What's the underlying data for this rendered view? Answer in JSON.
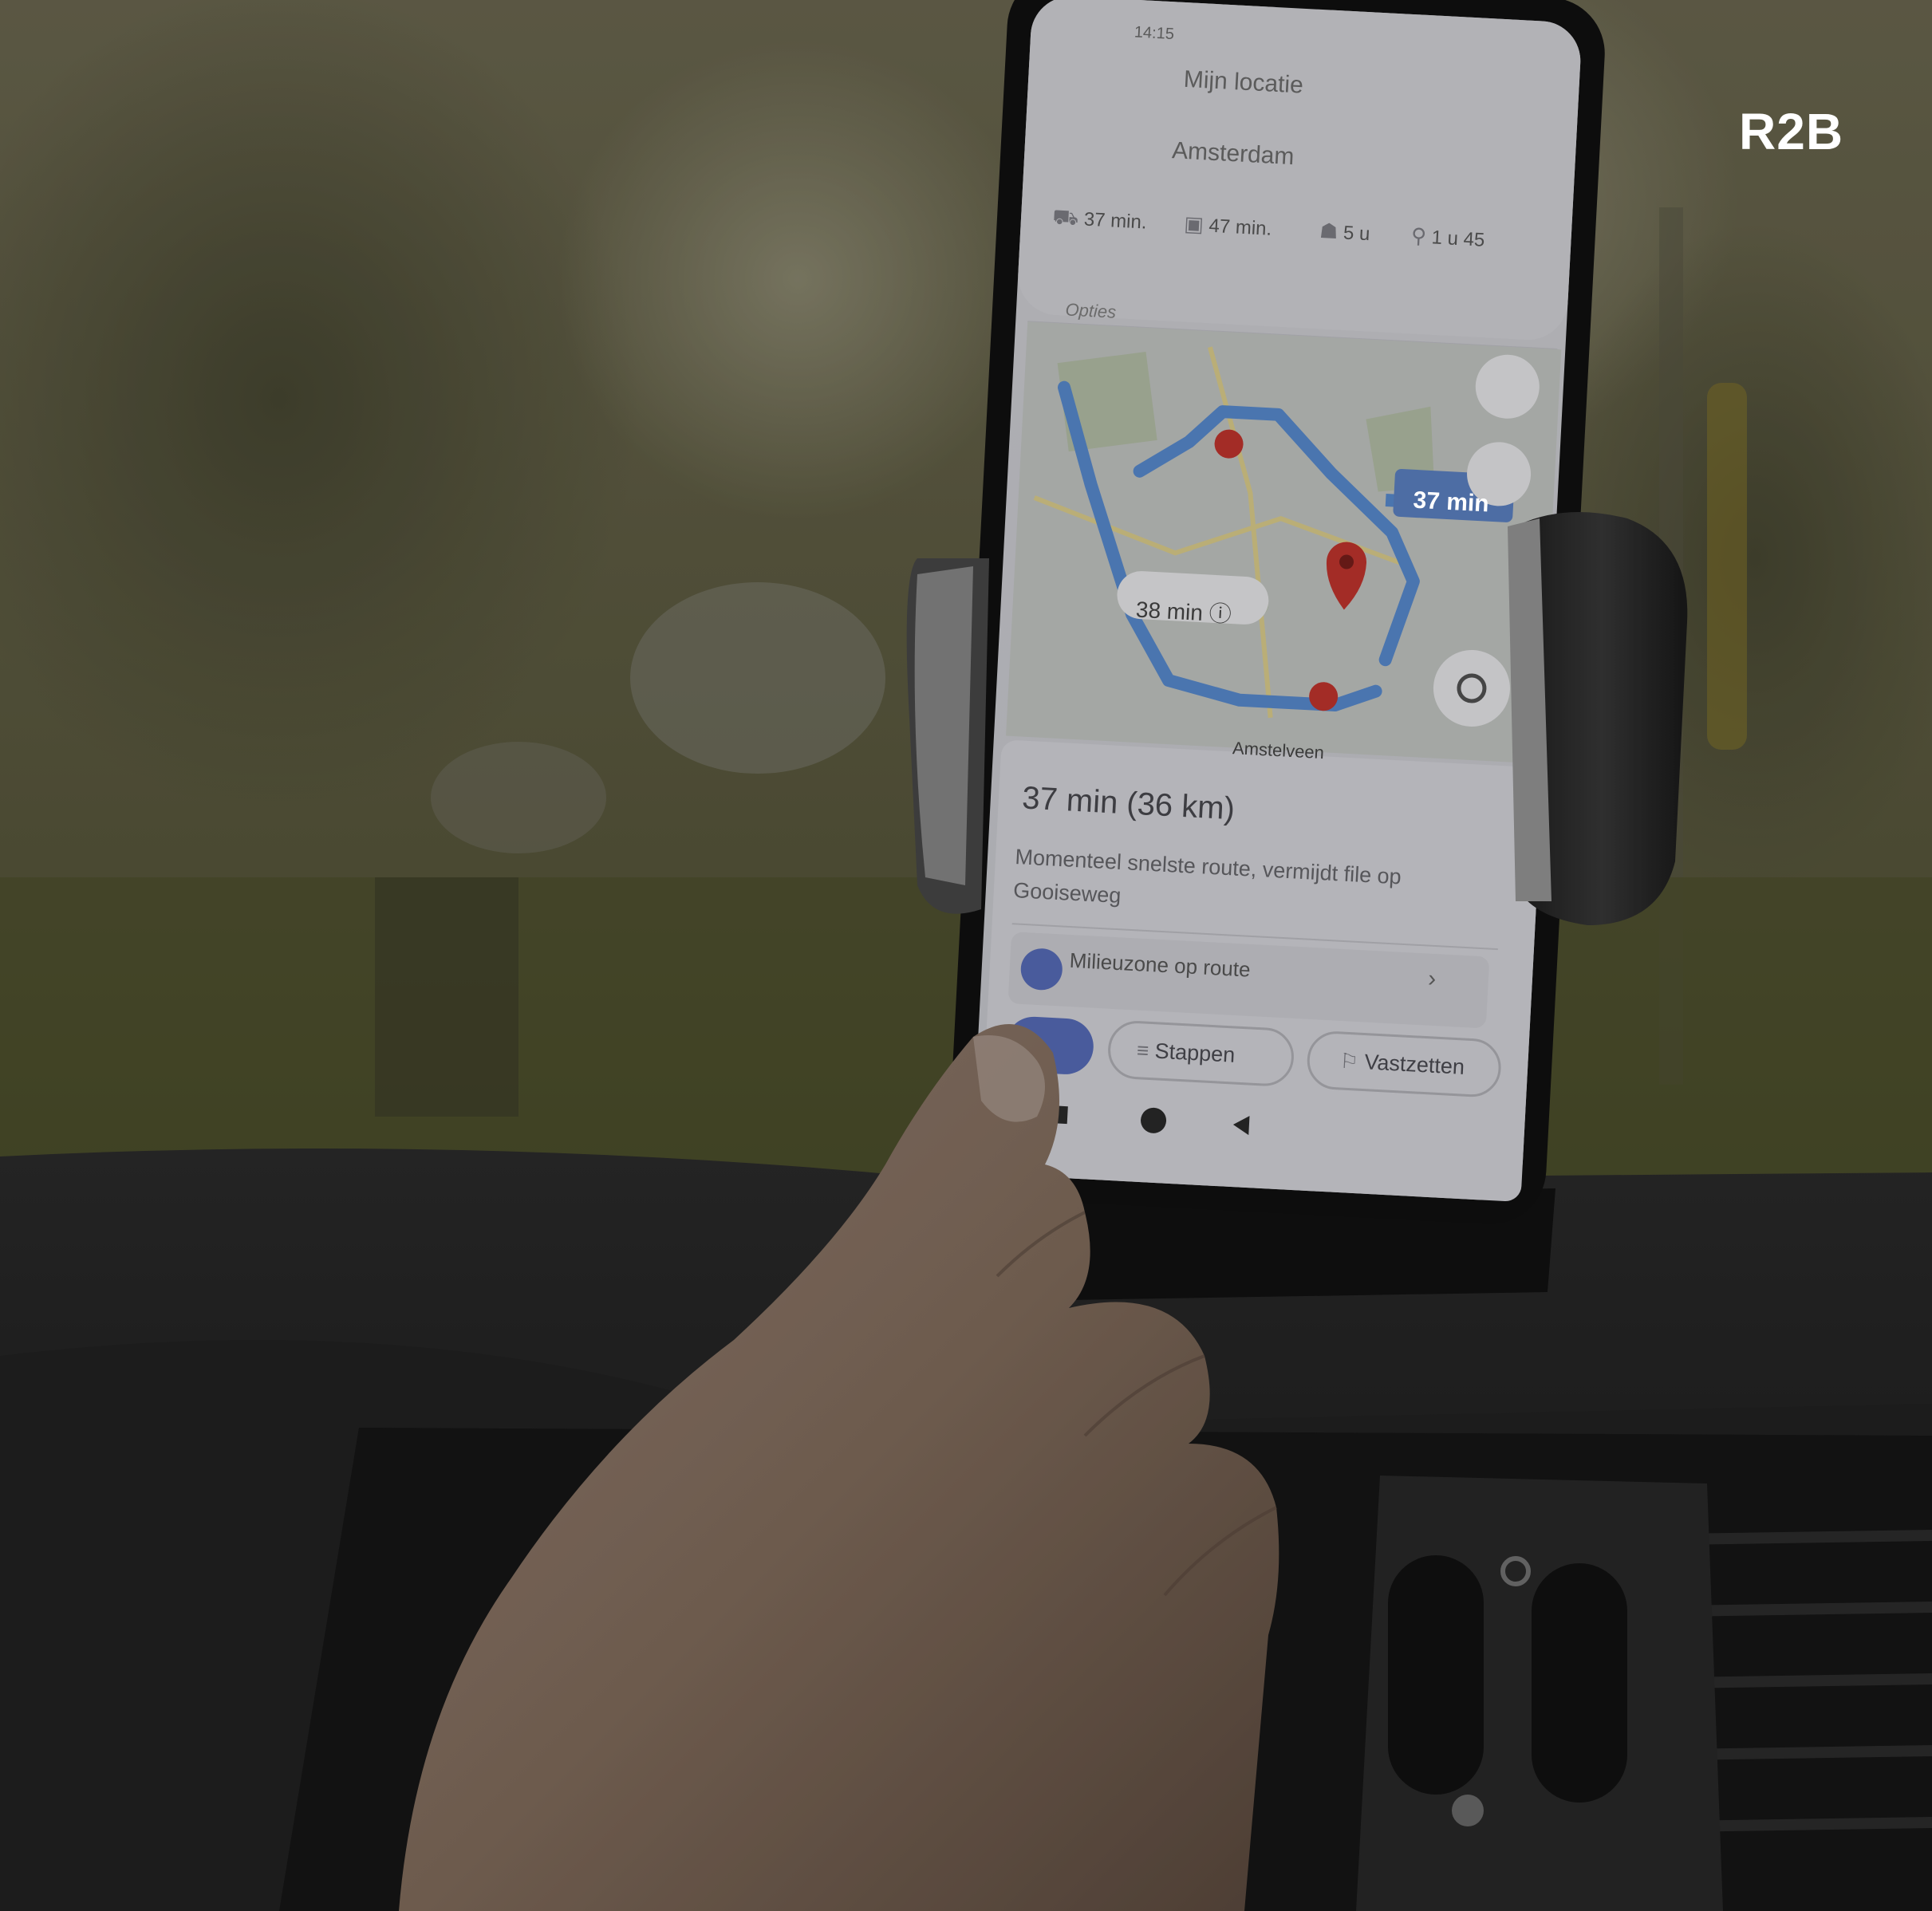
{
  "brand": {
    "logo_text": "R2B"
  },
  "phone": {
    "status_time": "14:15",
    "directions": {
      "from": "Mijn locatie",
      "to": "Amsterdam"
    },
    "modes": [
      {
        "icon": "car-icon",
        "label": "37 min."
      },
      {
        "icon": "transit-icon",
        "label": "47 min."
      },
      {
        "icon": "walk-icon",
        "label": "5 u"
      },
      {
        "icon": "bike-icon",
        "label": "1 u 45"
      }
    ],
    "options_label": "Opties",
    "map": {
      "primary_badge": "37 min",
      "alt_badge": "38 min ⓘ",
      "place_label": "Amstelveen"
    },
    "summary": {
      "eta": "37 min (36 km)",
      "description": "Momenteel snelste route, vermijdt file op Gooiseweg"
    },
    "notice": {
      "label": "Milieuzone op route",
      "chevron": "›"
    },
    "actions": [
      {
        "icon": "list-icon",
        "label": "Stappen"
      },
      {
        "icon": "pin-icon",
        "label": "Vastzetten"
      }
    ]
  },
  "colors": {
    "route": "#5b8fd6",
    "screen": "#dcdce2",
    "marker": "#c7362f",
    "accent": "#5a6fbf"
  }
}
